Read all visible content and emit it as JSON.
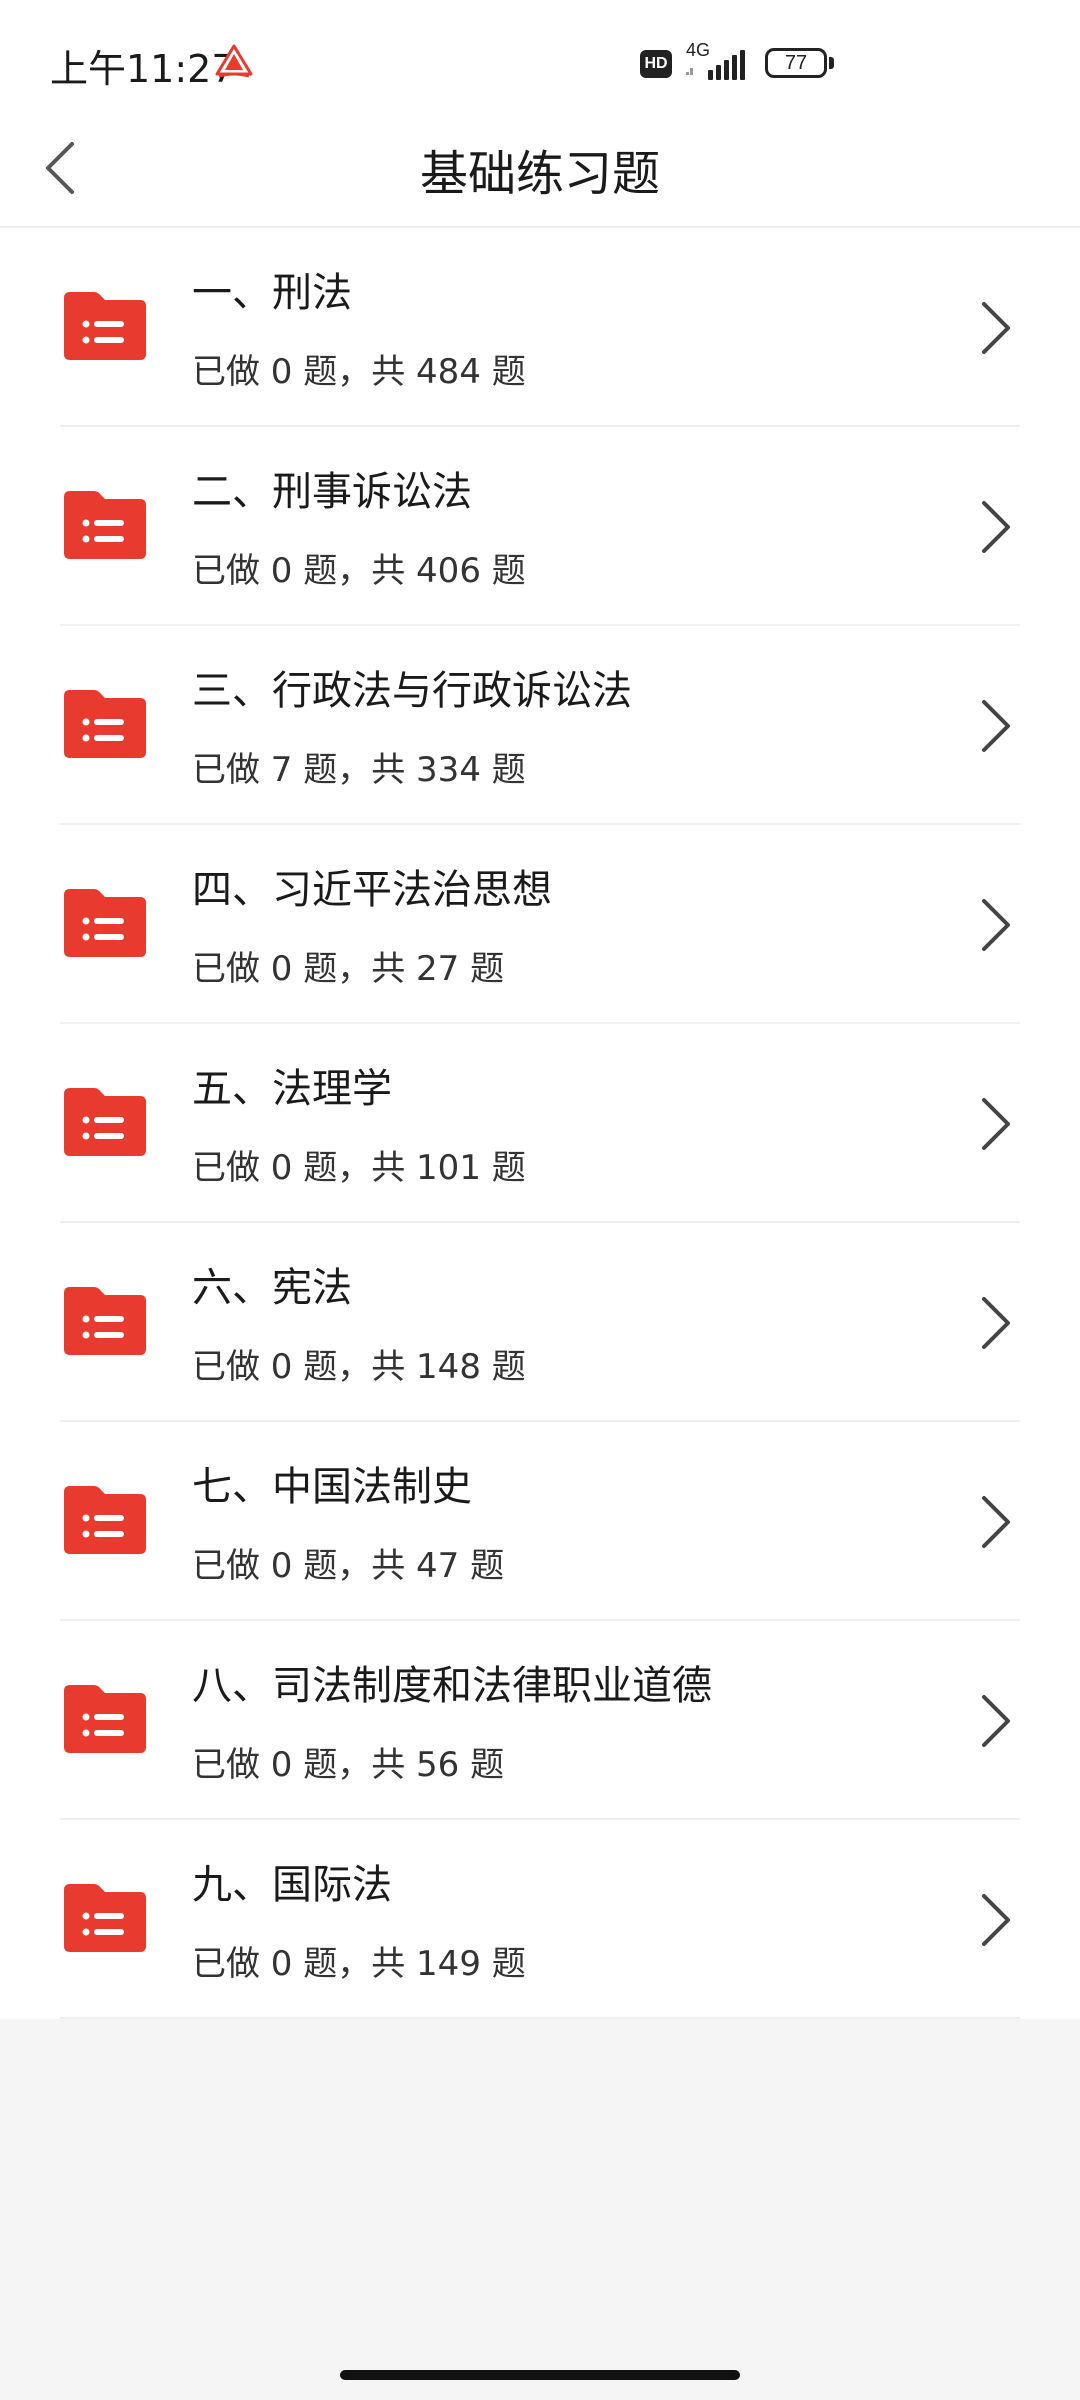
{
  "status_bar": {
    "time": "上午11:27",
    "hd_label": "HD",
    "network_label": "4G",
    "battery_level": "77",
    "app_icon": "mountain-app-icon"
  },
  "header": {
    "title": "基础练习题",
    "back_icon": "chevron-left-icon"
  },
  "list": {
    "items": [
      {
        "title": "一、刑法",
        "progress": "已做 0 题，共 484 题"
      },
      {
        "title": "二、刑事诉讼法",
        "progress": "已做 0 题，共 406 题"
      },
      {
        "title": "三、行政法与行政诉讼法",
        "progress": "已做 7 题，共 334 题"
      },
      {
        "title": "四、习近平法治思想",
        "progress": "已做 0 题，共 27 题"
      },
      {
        "title": "五、法理学",
        "progress": "已做 0 题，共 101 题"
      },
      {
        "title": "六、宪法",
        "progress": "已做 0 题，共 148 题"
      },
      {
        "title": "七、中国法制史",
        "progress": "已做 0 题，共 47 题"
      },
      {
        "title": "八、司法制度和法律职业道德",
        "progress": "已做 0 题，共 56 题"
      },
      {
        "title": "九、国际法",
        "progress": "已做 0 题，共 149 题"
      }
    ],
    "item_icon": "list-folder-icon",
    "arrow_icon": "chevron-right-icon"
  },
  "colors": {
    "accent": "#e83a2f",
    "background": "#f5f5f5",
    "surface": "#ffffff",
    "text_primary": "#1a1a1a",
    "divider": "#efefef"
  }
}
